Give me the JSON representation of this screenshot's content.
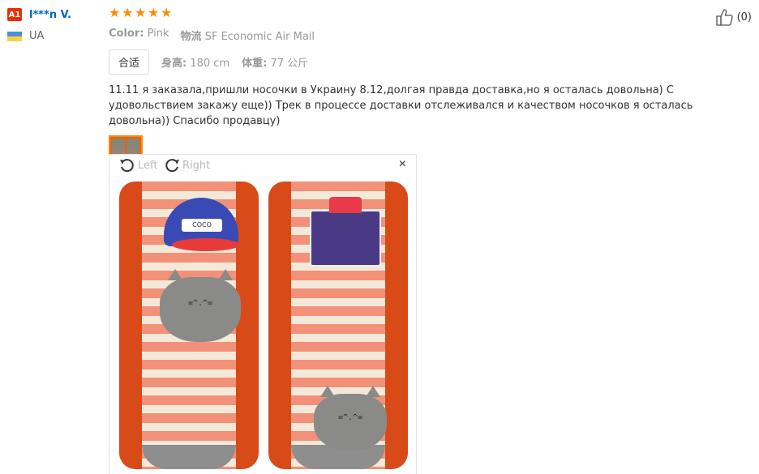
{
  "user": {
    "level_badge": "A1",
    "name": "l***n V.",
    "country": "UA",
    "flag_colors": [
      "#4a90d9",
      "#f5d33c"
    ]
  },
  "review": {
    "rating": 5,
    "star_color": "#ff8a00",
    "color_label": "Color:",
    "color_value": "Pink",
    "logistics_label": "物流",
    "logistics_value": "SF Economic Air Mail",
    "fit_tag": "合适",
    "height_label": "身高:",
    "height_value": "180 cm",
    "weight_label": "体重:",
    "weight_value": "77 公斤",
    "text": "11.11 я заказала,пришли носочки в Украину 8.12,долгая правда доставка,но я осталась довольна) С удовольствием закажу еще)) Трек в процессе доставки отслеживался и качеством носочков я осталась довольна)) Спасибо продавцу)"
  },
  "viewer": {
    "rotate_left_label": "Left",
    "rotate_right_label": "Right",
    "close_icon": "×",
    "brand_on_cap": "COCO"
  },
  "like": {
    "count": "(0)"
  }
}
